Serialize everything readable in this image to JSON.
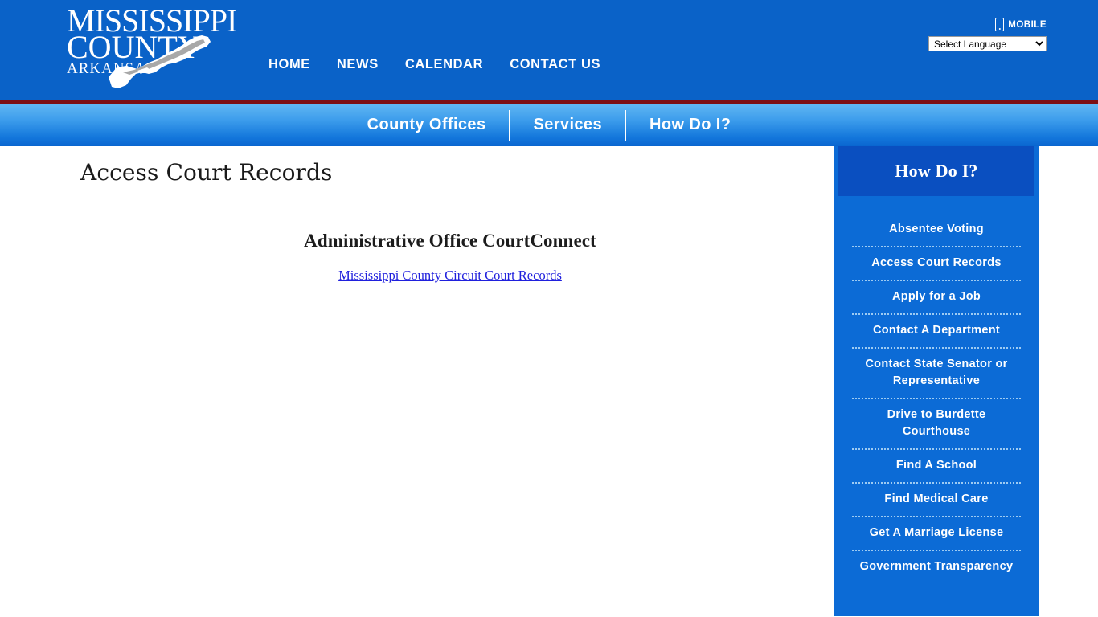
{
  "header": {
    "logo": {
      "line1": "MISSISSIPPI",
      "line2": "COUNTY",
      "line3": "ARKANSAS",
      "icon": "county-map-outline"
    },
    "nav": [
      {
        "label": "HOME"
      },
      {
        "label": "NEWS"
      },
      {
        "label": "CALENDAR"
      },
      {
        "label": "CONTACT US"
      }
    ],
    "mobile_label": "MOBILE",
    "mobile_icon": "mobile-phone-icon",
    "language": {
      "selected": "Select Language",
      "options": [
        "Select Language"
      ]
    },
    "bg_color": "#0A62C8",
    "rule_color": "#7C0F12"
  },
  "subnav": {
    "items": [
      {
        "label": "County Offices"
      },
      {
        "label": "Services"
      },
      {
        "label": "How Do I?"
      }
    ],
    "gradient_top": "#62B8F2",
    "gradient_bottom": "#0A66D0"
  },
  "main": {
    "page_title": "Access Court Records",
    "heading": "Administrative Office CourtConnect",
    "link_text": "Mississippi County Circuit Court Records",
    "link_color": "#2020DD"
  },
  "sidebar": {
    "title": "How Do I?",
    "bg_color": "#0C6BD6",
    "header_bg_color": "#0A4FC0",
    "items": [
      {
        "label": "Absentee Voting"
      },
      {
        "label": "Access Court Records"
      },
      {
        "label": "Apply for a Job"
      },
      {
        "label": "Contact A Department"
      },
      {
        "label": "Contact State Senator or Representative"
      },
      {
        "label": "Drive to Burdette Courthouse"
      },
      {
        "label": "Find A School"
      },
      {
        "label": "Find Medical Care"
      },
      {
        "label": "Get A Marriage License"
      },
      {
        "label": "Government Transparency"
      }
    ]
  }
}
